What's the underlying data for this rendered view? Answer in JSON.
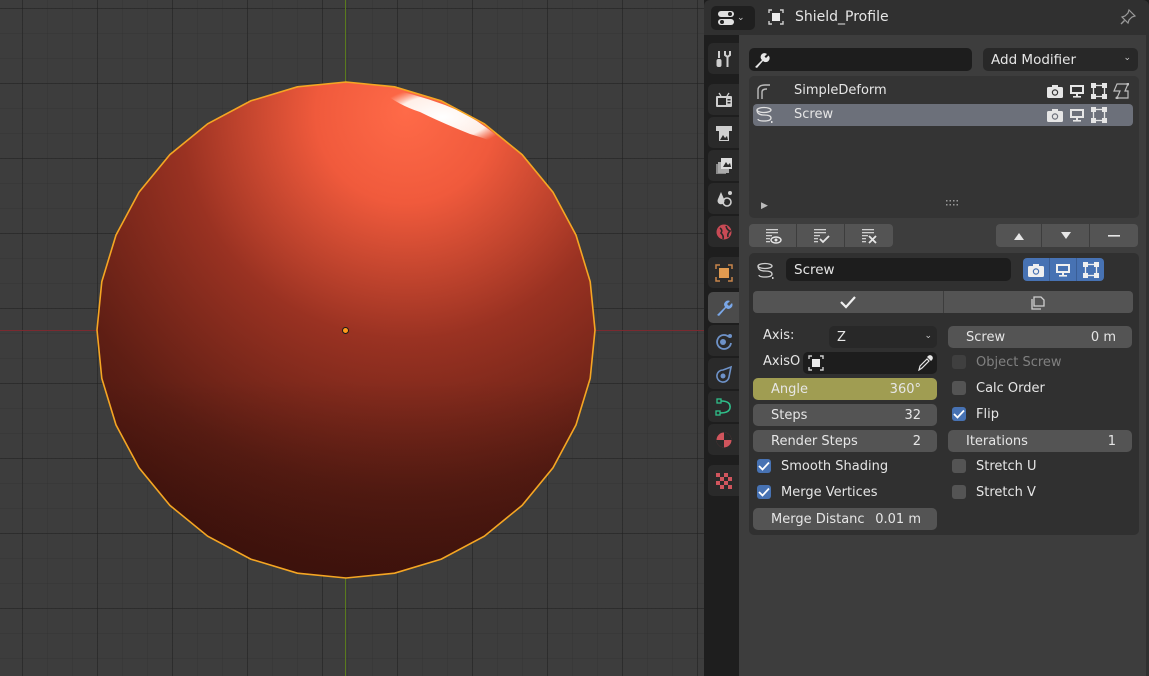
{
  "viewport": {
    "object_color": "#e05a3a",
    "selection_outline_color": "#f5a623",
    "x_axis_color": "#7a2a30",
    "y_axis_color": "#5a7a1e"
  },
  "header": {
    "object_name": "Shield_Profile",
    "editor_type_icon": "properties-editor-icon",
    "object_icon": "object-data-icon",
    "pin_icon": "pin-icon"
  },
  "tabs": [
    {
      "name": "tool",
      "icon": "tool-icon"
    },
    {
      "name": "render",
      "icon": "render-icon"
    },
    {
      "name": "output",
      "icon": "output-icon"
    },
    {
      "name": "view-layer",
      "icon": "view-layer-icon"
    },
    {
      "name": "scene",
      "icon": "scene-icon"
    },
    {
      "name": "world",
      "icon": "world-icon"
    },
    {
      "name": "object",
      "icon": "object-icon"
    },
    {
      "name": "modifiers",
      "icon": "wrench-icon",
      "active": true
    },
    {
      "name": "particles",
      "icon": "particles-icon"
    },
    {
      "name": "physics",
      "icon": "physics-icon"
    },
    {
      "name": "object-data",
      "icon": "curve-data-icon"
    },
    {
      "name": "material",
      "icon": "material-icon"
    },
    {
      "name": "texture",
      "icon": "texture-icon"
    }
  ],
  "toolbar": {
    "search_value": "",
    "add_modifier_label": "Add Modifier"
  },
  "modifier_list": [
    {
      "name": "SimpleDeform",
      "icon": "simple-deform-icon",
      "selected": false,
      "render": true,
      "viewport": true,
      "editmode": true,
      "cage": true
    },
    {
      "name": "Screw",
      "icon": "screw-icon",
      "selected": true,
      "render": true,
      "viewport": true,
      "editmode": true,
      "cage": false
    }
  ],
  "active_modifier": {
    "name": "Screw",
    "axis_label": "Axis:",
    "axis_value": "Z",
    "axis_object_label": "AxisO",
    "axis_object_value": "",
    "angle_label": "Angle",
    "angle_value": "360°",
    "steps_label": "Steps",
    "steps_value": "32",
    "render_steps_label": "Render Steps",
    "render_steps_value": "2",
    "smooth_shading_label": "Smooth Shading",
    "smooth_shading": true,
    "merge_vertices_label": "Merge Vertices",
    "merge_vertices": true,
    "merge_distance_label": "Merge Distanc",
    "merge_distance_value": "0.01 m",
    "screw_label": "Screw",
    "screw_value": "0 m",
    "object_screw_label": "Object Screw",
    "object_screw": false,
    "calc_order_label": "Calc Order",
    "calc_order": false,
    "flip_label": "Flip",
    "flip": true,
    "iterations_label": "Iterations",
    "iterations_value": "1",
    "stretch_u_label": "Stretch U",
    "stretch_u": false,
    "stretch_v_label": "Stretch V",
    "stretch_v": false
  },
  "colors": {
    "accent_blue": "#4772b3",
    "active_field": "#a09d52",
    "selected_row": "#6c707a"
  }
}
